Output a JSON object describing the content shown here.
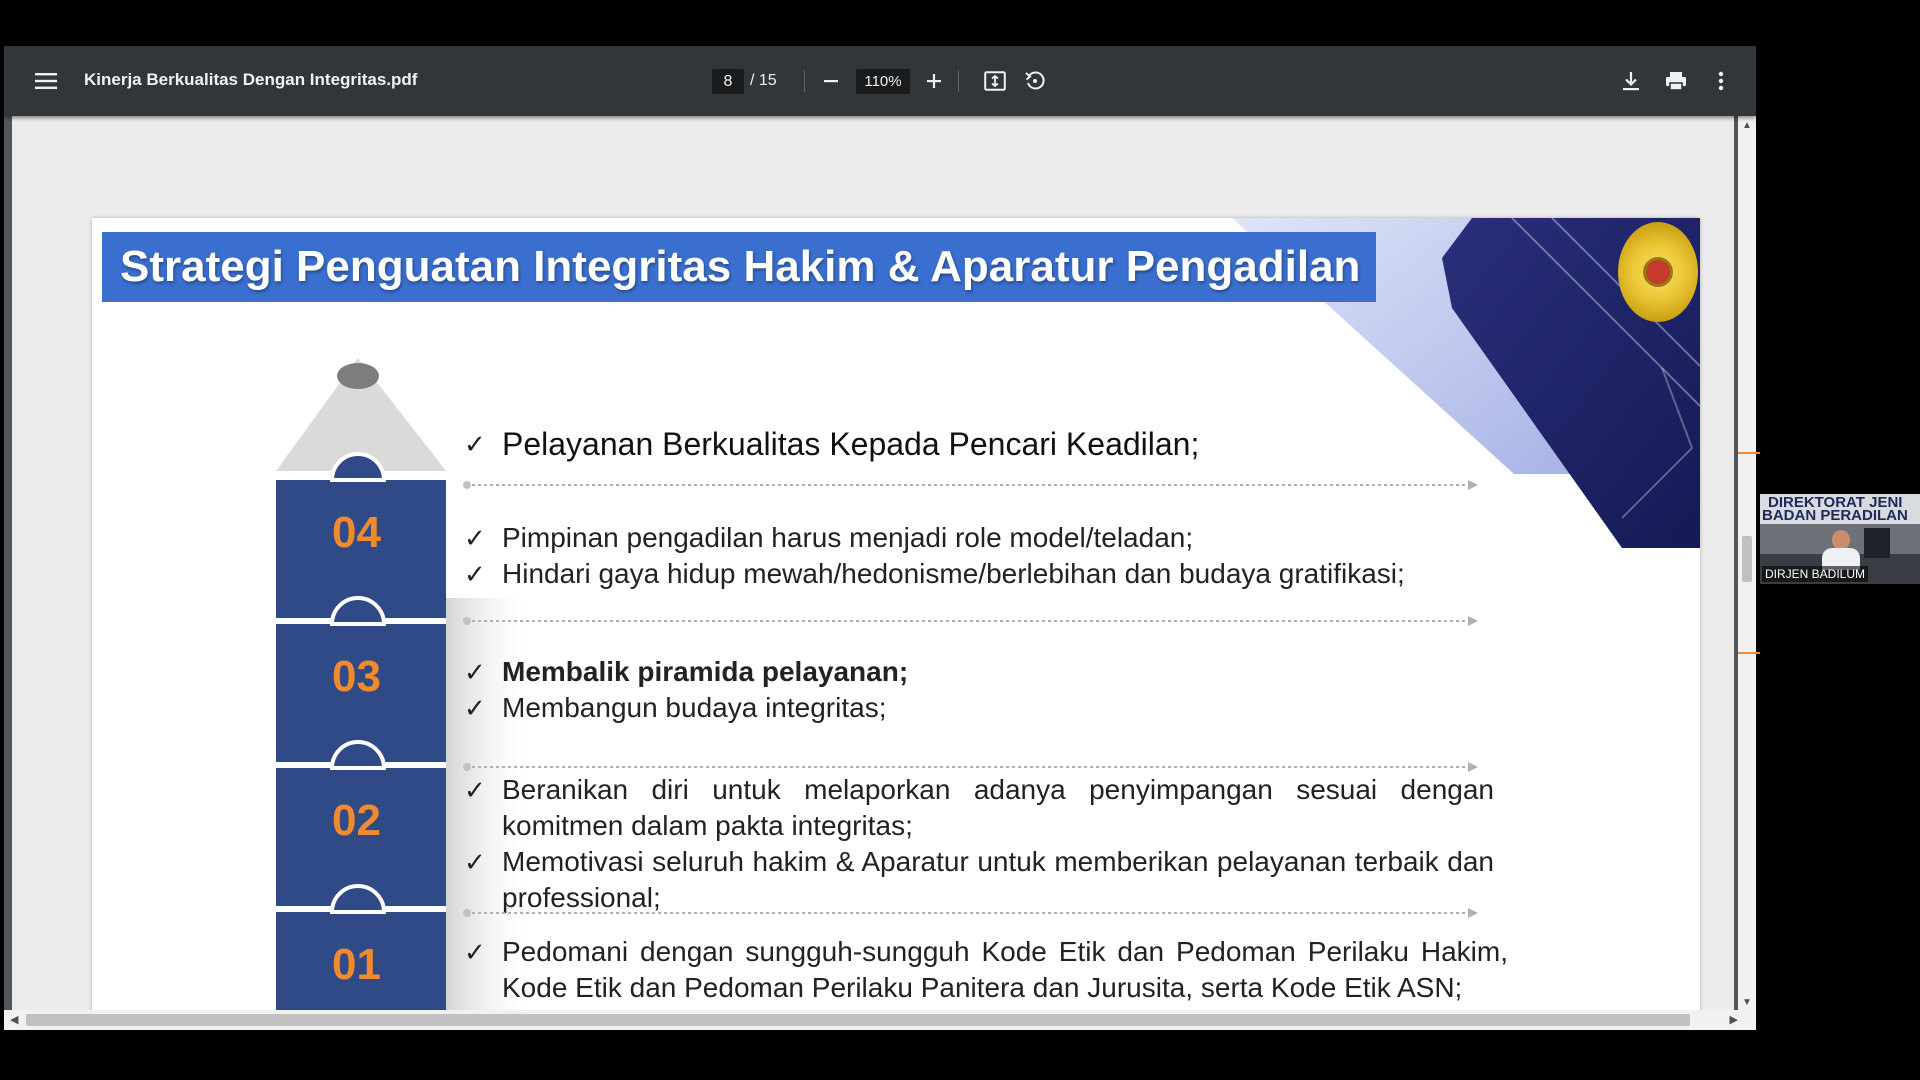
{
  "toolbar": {
    "doc_title": "Kinerja Berkualitas Dengan Integritas.pdf",
    "current_page": "8",
    "total_pages": "/ 15",
    "zoom": "110%",
    "icons": {
      "menu": "hamburger-menu-icon",
      "zoom_out": "minus-icon",
      "zoom_in": "plus-icon",
      "fit": "fit-to-page-icon",
      "rotate": "rotate-icon",
      "download": "download-icon",
      "print": "print-icon",
      "more": "more-vertical-icon"
    }
  },
  "slide": {
    "title": "Strategi Penguatan Integritas Hakim & Aparatur Pengadilan",
    "levels": [
      {
        "number": "04"
      },
      {
        "number": "03"
      },
      {
        "number": "02"
      },
      {
        "number": "01"
      }
    ],
    "check_mark": "✓",
    "top_statement": "Pelayanan Berkualitas Kepada Pencari Keadilan;",
    "group_04": [
      "Pimpinan pengadilan harus menjadi role model/teladan;",
      "Hindari gaya hidup mewah/hedonisme/berlebihan dan budaya gratifikasi;"
    ],
    "group_03": [
      "Membalik piramida pelayanan;",
      "Membangun budaya integritas;"
    ],
    "group_02": [
      "Beranikan diri untuk melaporkan adanya penyimpangan sesuai dengan komitmen dalam pakta integritas;",
      "Memotivasi seluruh hakim & Aparatur untuk memberikan pelayanan terbaik dan professional;"
    ],
    "group_01": [
      "Pedomani dengan sungguh-sungguh Kode Etik dan Pedoman Perilaku Hakim, Kode Etik dan Pedoman Perilaku Panitera dan Jurusita, serta Kode Etik ASN;"
    ],
    "colors": {
      "title_bar": "#3a6fcf",
      "pencil_block": "#2f4a86",
      "number": "#f08a2c",
      "decor_dark": "#1e2866"
    }
  },
  "video": {
    "banner_line1": "DIREKTORAT JENI",
    "banner_line2": "BADAN PERADILAN",
    "name_tag": "DIRJEN BADILUM"
  }
}
